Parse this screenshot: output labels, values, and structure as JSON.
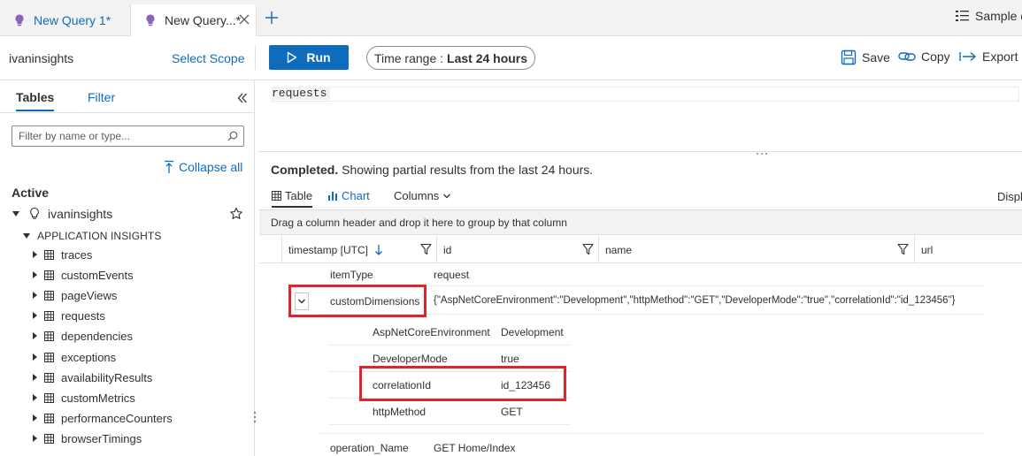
{
  "tabs": [
    {
      "label": "New Query 1*",
      "active": false
    },
    {
      "label": "New Query...*",
      "active": true
    }
  ],
  "sample_queries_label": "Sample q",
  "toolbar": {
    "workspace": "ivaninsights",
    "select_scope": "Select Scope",
    "run": "Run",
    "time_range_prefix": "Time range :",
    "time_range_value": "Last 24 hours",
    "save": "Save",
    "copy": "Copy",
    "export": "Export"
  },
  "left_pane": {
    "tab_tables": "Tables",
    "tab_filter": "Filter",
    "filter_placeholder": "Filter by name or type...",
    "collapse_all": "Collapse all",
    "active_label": "Active",
    "workspace_node": "ivaninsights",
    "group_label": "APPLICATION INSIGHTS",
    "tables": [
      "traces",
      "customEvents",
      "pageViews",
      "requests",
      "dependencies",
      "exceptions",
      "availabilityResults",
      "customMetrics",
      "performanceCounters",
      "browserTimings"
    ]
  },
  "editor": {
    "query": "requests"
  },
  "results": {
    "status_bold": "Completed.",
    "status_text": "Showing partial results from the last 24 hours.",
    "tab_table": "Table",
    "tab_chart": "Chart",
    "columns_btn": "Columns",
    "display_label": "Displ",
    "group_hint": "Drag a column header and drop it here to group by that column",
    "columns": [
      "timestamp [UTC]",
      "id",
      "name",
      "url"
    ],
    "detail_rows": [
      {
        "key": "itemType",
        "value": "request"
      },
      {
        "key": "customDimensions",
        "value": "{\"AspNetCoreEnvironment\":\"Development\",\"httpMethod\":\"GET\",\"DeveloperMode\":\"true\",\"correlationId\":\"id_123456\"}"
      }
    ],
    "nested_rows": [
      {
        "key": "AspNetCoreEnvironment",
        "value": "Development"
      },
      {
        "key": "DeveloperMode",
        "value": "true"
      },
      {
        "key": "correlationId",
        "value": "id_123456"
      },
      {
        "key": "httpMethod",
        "value": "GET"
      }
    ],
    "last_row": {
      "key": "operation_Name",
      "value": "GET Home/Index"
    }
  },
  "colors": {
    "accent": "#0f6cbd",
    "highlight": "#d92630",
    "query_icon": "#8764b8"
  }
}
